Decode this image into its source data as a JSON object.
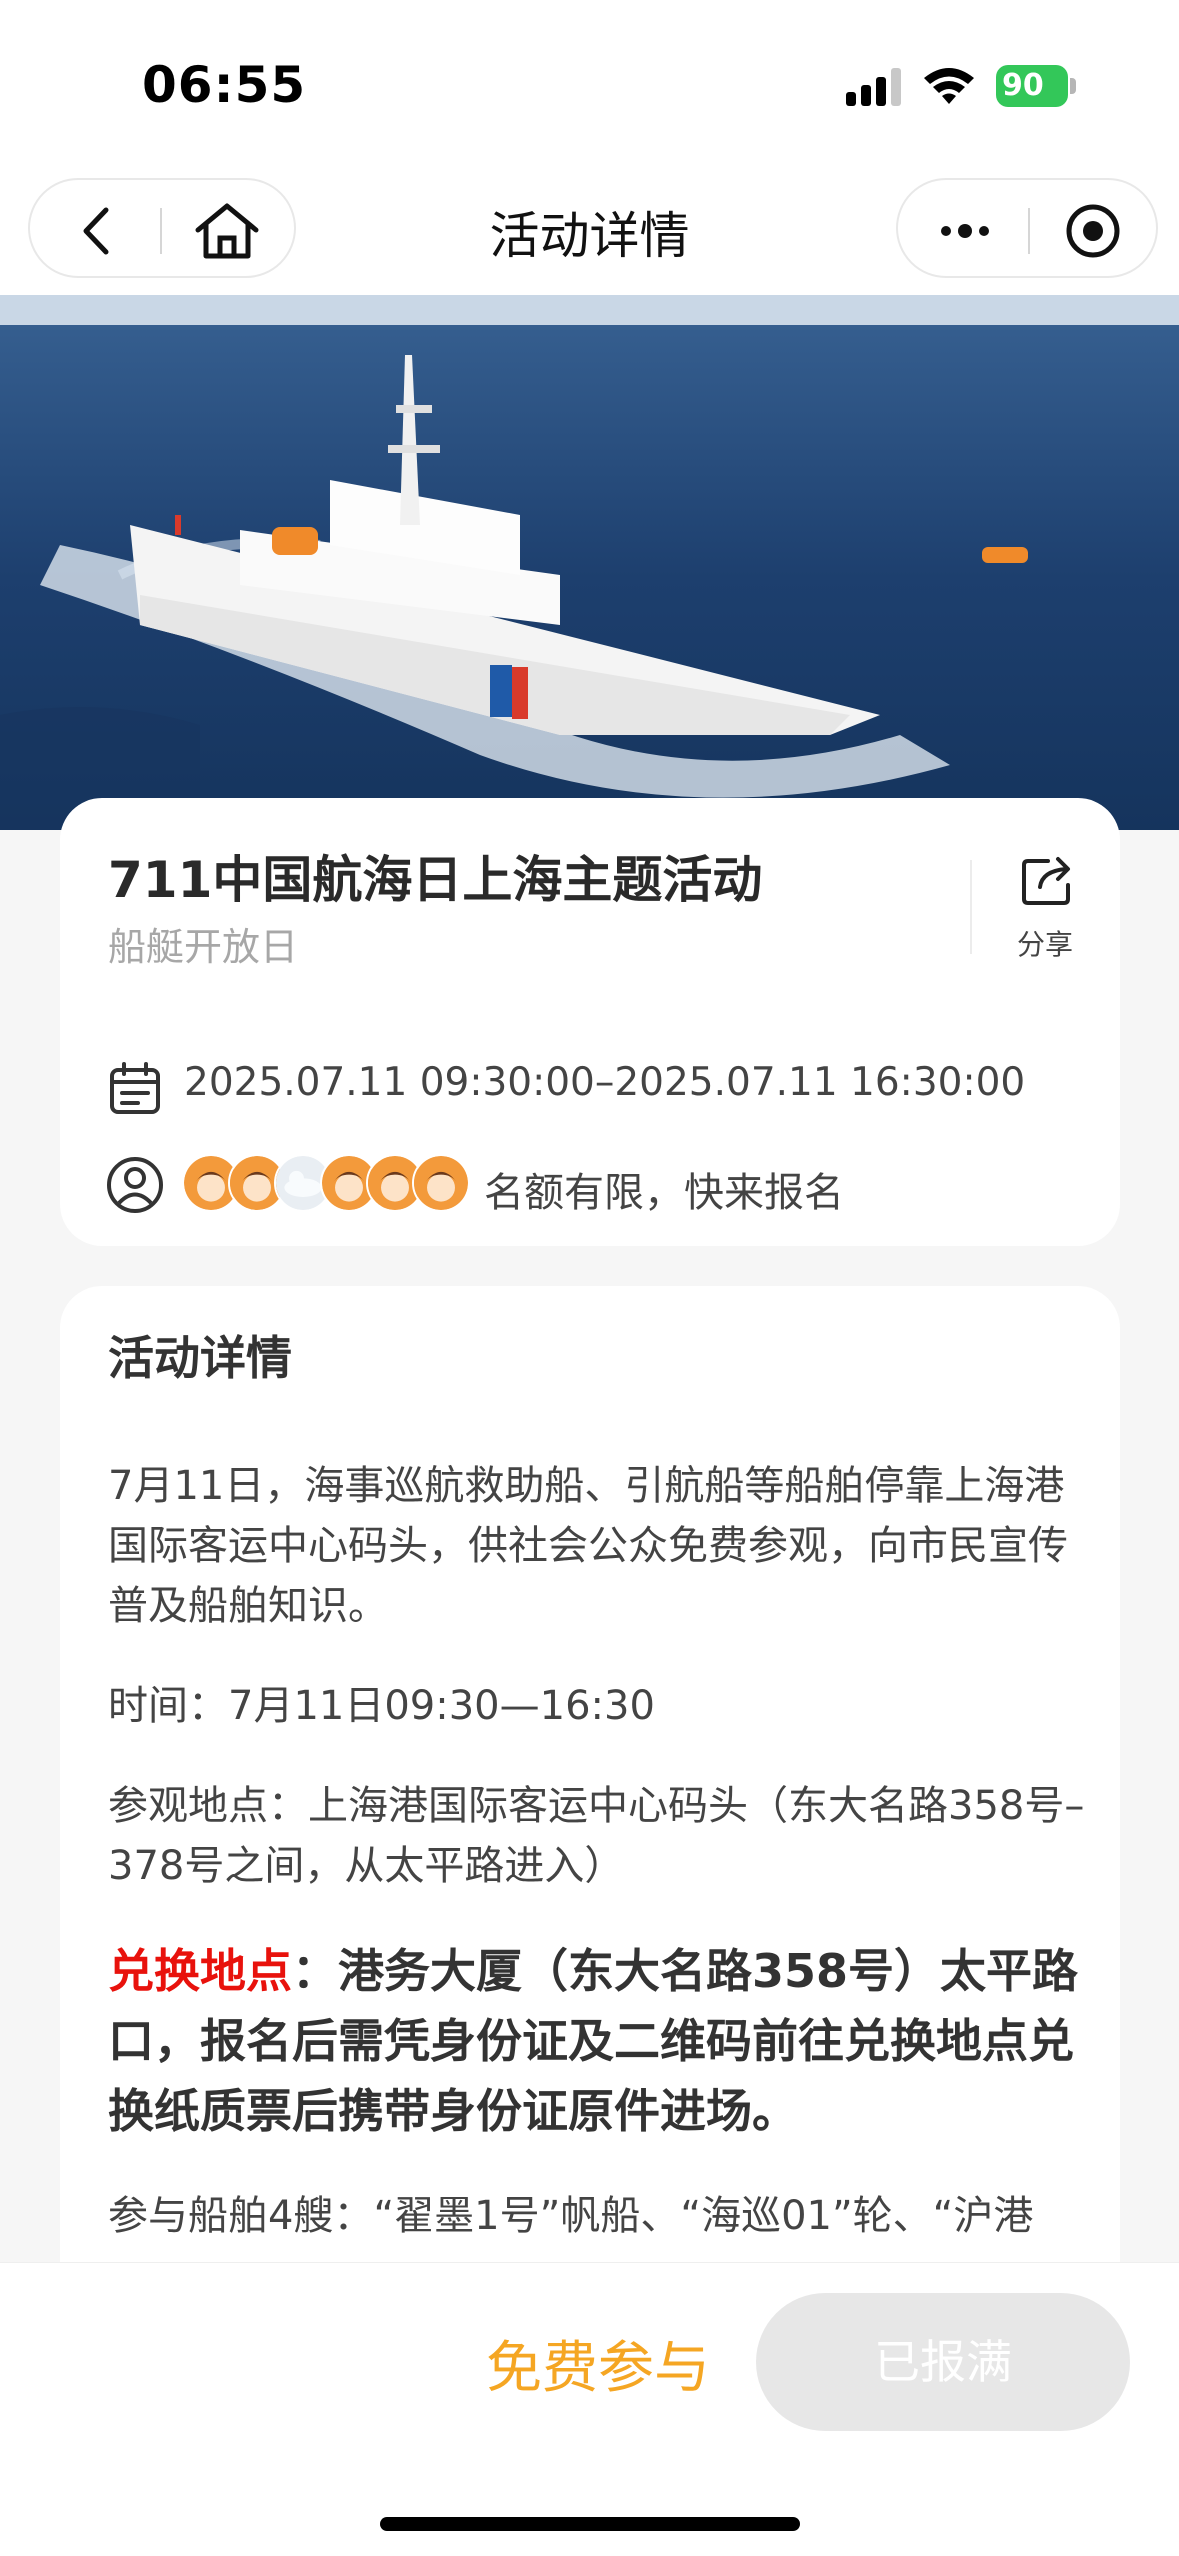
{
  "status_bar": {
    "time": "06:55",
    "battery": "90"
  },
  "nav": {
    "title": "活动详情"
  },
  "event": {
    "title": "711中国航海日上海主题活动",
    "subtitle": "船艇开放日",
    "share_label": "分享",
    "time_range": "2025.07.11 09:30:00–2025.07.11 16:30:00",
    "quota_text": "名额有限，快来报名"
  },
  "detail": {
    "heading": "活动详情",
    "intro": "7月11日，海事巡航救助船、引航船等船舶停靠上海港国际客运中心码头，供社会公众免费参观，向市民宣传普及船舶知识。",
    "time": "时间：7月11日09:30—16:30",
    "location": "参观地点：上海港国际客运中心码头（东大名路358号–378号之间，从太平路进入）",
    "exchange_label": "兑换地点",
    "exchange_text": "：港务大厦（东大名路358号）太平路口，报名后需凭身份证及二维码前往兑换地点兑换纸质票后携带身份证原件进场。",
    "ships": "参与船舶4艘：“翟墨1号”帆船、“海巡01”轮、“沪港"
  },
  "bottom": {
    "free_join": "免费参与",
    "full_label": "已报满"
  },
  "colors": {
    "accent_orange": "#f5a623",
    "highlight_red": "#e8120c",
    "battery_green": "#33c759"
  },
  "icons": [
    "back-icon",
    "home-icon",
    "more-icon",
    "target-icon",
    "share-icon",
    "calendar-icon",
    "user-icon"
  ]
}
